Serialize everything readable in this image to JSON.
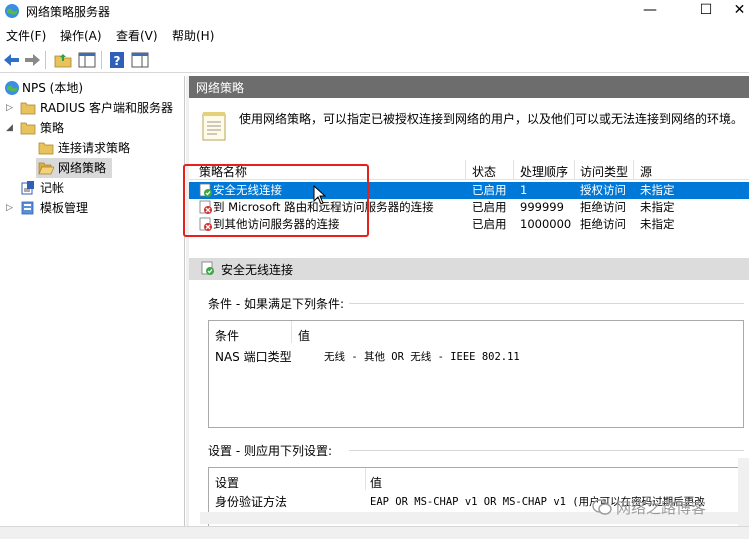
{
  "window": {
    "title": "网络策略服务器",
    "minimize_glyph": "—",
    "maximize_glyph": "☐",
    "close_glyph": "✕"
  },
  "menu": [
    "文件(F)",
    "操作(A)",
    "查看(V)",
    "帮助(H)"
  ],
  "tree": {
    "root": "NPS (本地)",
    "radius": "RADIUS 客户端和服务器",
    "policies": "策略",
    "connection_request": "连接请求策略",
    "network_policies": "网络策略",
    "accounting": "记帐",
    "templates": "模板管理"
  },
  "main": {
    "header": "网络策略",
    "intro": "使用网络策略，可以指定已被授权连接到网络的用户，以及他们可以或无法连接到网络的环境。",
    "columns": [
      "策略名称",
      "状态",
      "处理顺序",
      "访问类型",
      "源"
    ],
    "rows": [
      {
        "name": "安全无线连接",
        "status": "已启用",
        "order": "1",
        "access": "授权访问",
        "source": "未指定",
        "icon": "allow-policy-icon"
      },
      {
        "name": "到 Microsoft 路由和远程访问服务器的连接",
        "status": "已启用",
        "order": "999999",
        "access": "拒绝访问",
        "source": "未指定",
        "icon": "deny-policy-icon"
      },
      {
        "name": "到其他访问服务器的连接",
        "status": "已启用",
        "order": "1000000",
        "access": "拒绝访问",
        "source": "未指定",
        "icon": "deny-policy-icon"
      }
    ],
    "detail_title": "安全无线连接",
    "conditions_label": "条件 - 如果满足下列条件:",
    "conditions_cols": [
      "条件",
      "值"
    ],
    "conditions_rows": [
      {
        "condition": "NAS 端口类型",
        "value": "无线 - 其他 OR 无线 - IEEE 802.11"
      }
    ],
    "settings_label": "设置 - 则应用下列设置:",
    "settings_cols": [
      "设置",
      "值"
    ],
    "settings_rows": [
      {
        "setting": "身份验证方法",
        "value": "EAP OR MS-CHAP v1 OR MS-CHAP v1 (用户可以在密码过期后更改"
      }
    ]
  },
  "watermark": "网络之路博客",
  "colors": {
    "selection": "#0078d7",
    "header_bar": "#6d6d6d",
    "annotation": "#e8201a"
  }
}
